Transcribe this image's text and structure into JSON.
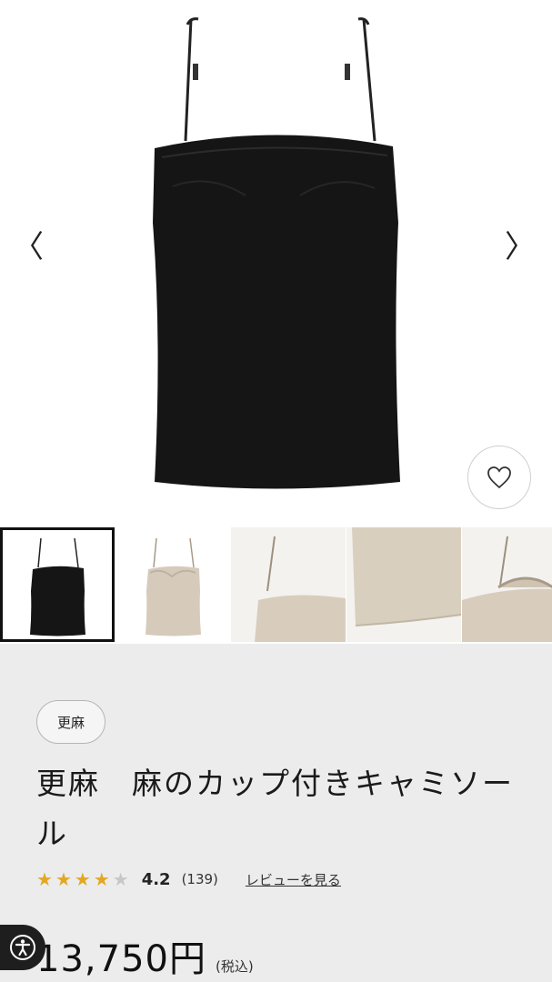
{
  "gallery": {
    "prev_arrow": "〈",
    "next_arrow": "〉",
    "favorite_icon": "heart-icon",
    "thumbnails": [
      {
        "label": "black camisole front",
        "selected": true
      },
      {
        "label": "beige camisole front",
        "selected": false
      },
      {
        "label": "beige strap detail",
        "selected": false
      },
      {
        "label": "beige fabric hem detail",
        "selected": false
      },
      {
        "label": "beige cup detail",
        "selected": false
      }
    ]
  },
  "product": {
    "brand": "更麻",
    "title": "更麻　麻のカップ付きキャミソール",
    "rating": {
      "value": "4.2",
      "count": "(139)",
      "stars_filled": 4,
      "stars_total": 5,
      "review_link": "レビューを見る"
    },
    "price": "13,750円",
    "tax_note": "(税込)"
  },
  "colors": {
    "star": "#e3a823",
    "background": "#ececec"
  },
  "accessibility": {
    "icon": "accessibility-icon"
  }
}
